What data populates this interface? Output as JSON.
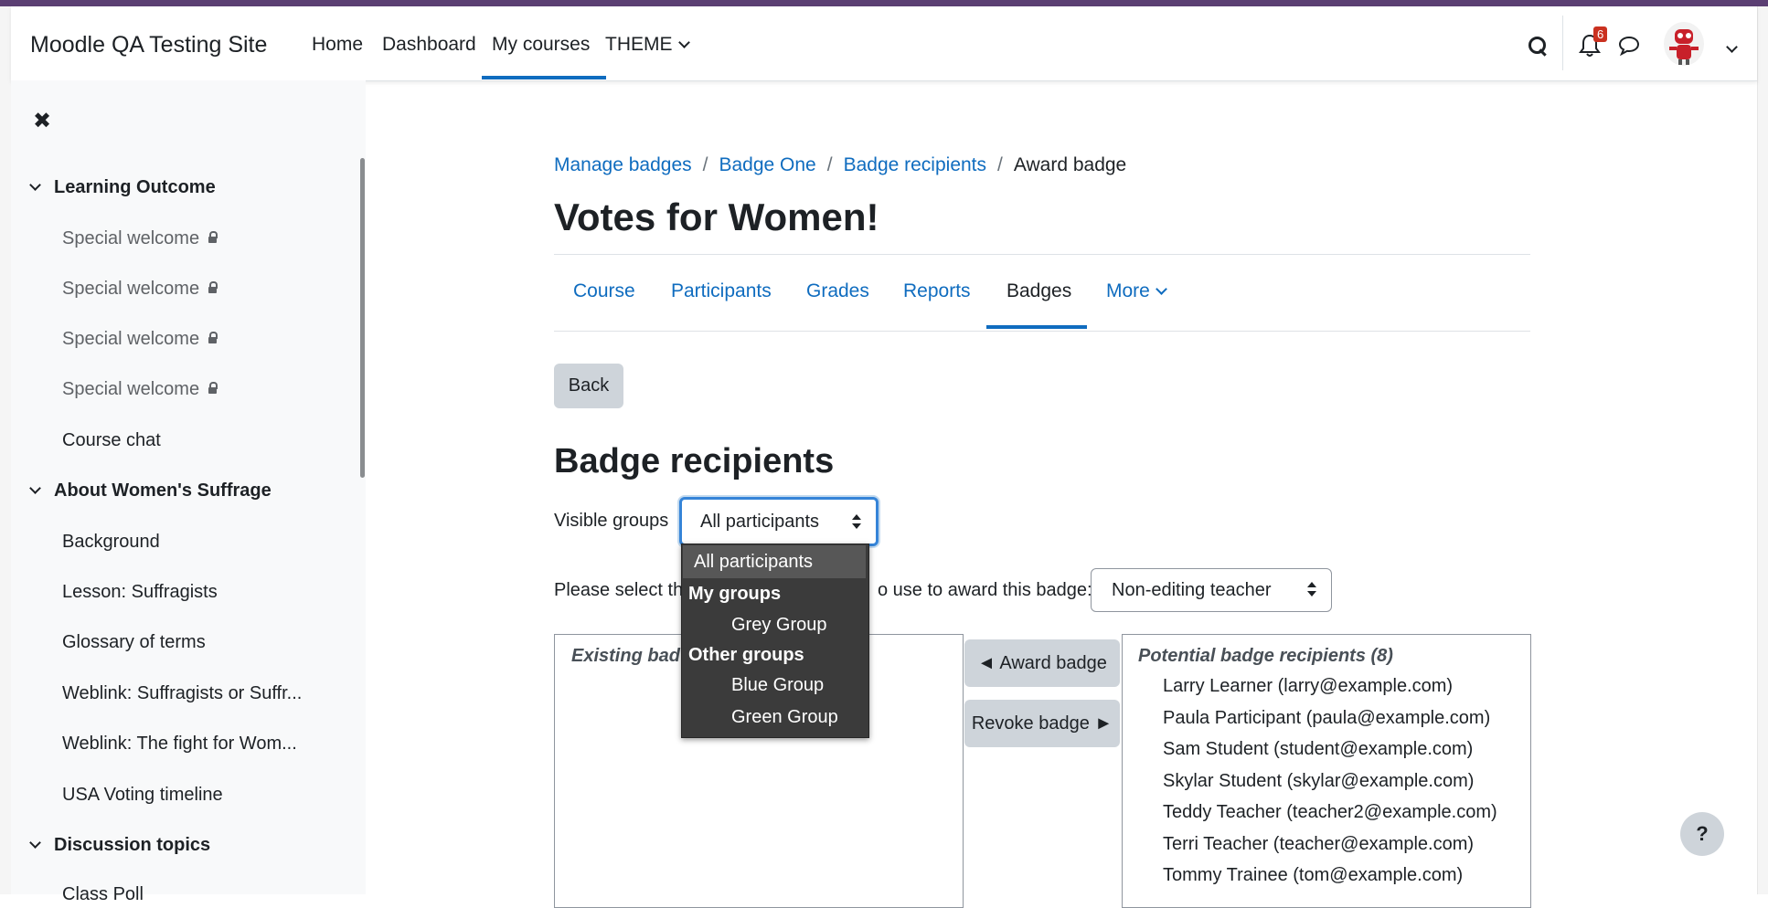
{
  "site": {
    "name": "Moodle QA Testing Site"
  },
  "topnav": {
    "home": "Home",
    "dashboard": "Dashboard",
    "my_courses": "My courses",
    "theme": "THEME",
    "notification_count": "6"
  },
  "drawer": {
    "close": "✖",
    "sections": [
      {
        "title": "Learning Outcome"
      },
      {
        "title": "About Women's Suffrage"
      },
      {
        "title": "Discussion topics"
      }
    ],
    "items": [
      "Special welcome",
      "Special welcome",
      "Special welcome",
      "Special welcome",
      "Course chat",
      "Background",
      "Lesson: Suffragists",
      "Glossary of terms",
      "Weblink: Suffragists or Suffr...",
      "Weblink: The fight for Wom...",
      "USA Voting timeline",
      "Class Poll"
    ]
  },
  "breadcrumb": {
    "items": [
      "Manage badges",
      "Badge One",
      "Badge recipients"
    ],
    "current": "Award badge",
    "separator": "/"
  },
  "page": {
    "title": "Votes for Women!"
  },
  "secnav": {
    "tabs": [
      "Course",
      "Participants",
      "Grades",
      "Reports",
      "Badges",
      "More"
    ],
    "active": "Badges"
  },
  "main": {
    "back_label": "Back",
    "heading": "Badge recipients",
    "visible_groups_label": "Visible groups",
    "visible_groups_value": "All participants",
    "role_prompt_left": "Please select th",
    "role_prompt_right": "o use to award this badge:",
    "role_value": "Non-editing teacher",
    "existing_head": "Existing bad",
    "award_label": "◄ Award badge",
    "revoke_label": "Revoke badge ►",
    "potential_head": "Potential badge recipients (8)",
    "potential": [
      "Larry Learner (larry@example.com)",
      "Paula Participant (paula@example.com)",
      "Sam Student (student@example.com)",
      "Skylar Student (skylar@example.com)",
      "Teddy Teacher (teacher2@example.com)",
      "Terri Teacher (teacher@example.com)",
      "Tommy Trainee (tom@example.com)"
    ]
  },
  "group_dropdown": {
    "selected": "All participants",
    "my_groups_label": "My groups",
    "my_groups": [
      "Grey Group"
    ],
    "other_groups_label": "Other groups",
    "other_groups": [
      "Blue Group",
      "Green Group"
    ]
  },
  "help": {
    "label": "?"
  },
  "colors": {
    "accent": "#0f6cbf",
    "brand_stripe": "#5b3f73",
    "notification": "#ca3120"
  }
}
